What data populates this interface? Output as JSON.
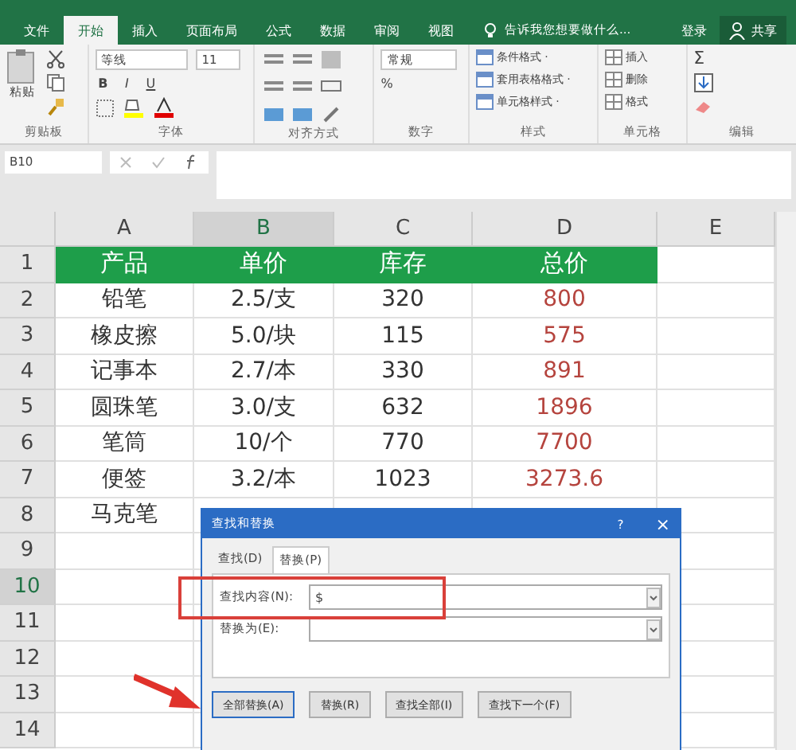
{
  "ribbon_tabs": [
    {
      "label": "文件",
      "selected": false
    },
    {
      "label": "开始",
      "selected": true
    },
    {
      "label": "插入",
      "selected": false
    },
    {
      "label": "页面布局",
      "selected": false
    },
    {
      "label": "公式",
      "selected": false
    },
    {
      "label": "数据",
      "selected": false
    },
    {
      "label": "审阅",
      "selected": false
    },
    {
      "label": "视图",
      "selected": false
    }
  ],
  "tell_me": "告诉我您想要做什么...",
  "sign_in": "登录",
  "share": "共享",
  "ribbon": {
    "paste": "粘贴",
    "font_name": "等线",
    "font_size": "11",
    "bold": "B",
    "italic": "I",
    "underline": "U",
    "number_format": "常规",
    "percent": "%",
    "styles": [
      "条件格式 ·",
      "套用表格格式 ·",
      "单元格样式 ·"
    ],
    "cells": [
      "插入",
      "删除",
      "格式"
    ],
    "sum": "Σ",
    "groups": [
      "剪贴板",
      "字体",
      "对齐方式",
      "数字",
      "样式",
      "单元格",
      "编辑"
    ]
  },
  "name_box": "B10",
  "columns": [
    {
      "label": "A",
      "selected": false,
      "kind": "text"
    },
    {
      "label": "B",
      "selected": true,
      "kind": "text"
    },
    {
      "label": "C",
      "selected": false,
      "kind": "text"
    },
    {
      "label": "D",
      "selected": false,
      "kind": "total"
    },
    {
      "label": "E",
      "selected": false,
      "kind": "text"
    }
  ],
  "rows": [
    {
      "label": "1",
      "selected": false,
      "kind": "header",
      "cells": [
        "产品",
        "单价",
        "库存",
        "总价"
      ]
    },
    {
      "label": "2",
      "selected": false,
      "kind": "data",
      "cells": [
        "铅笔",
        "2.5/支",
        "320",
        "800"
      ]
    },
    {
      "label": "3",
      "selected": false,
      "kind": "data",
      "cells": [
        "橡皮擦",
        "5.0/块",
        "115",
        "575"
      ]
    },
    {
      "label": "4",
      "selected": false,
      "kind": "data",
      "cells": [
        "记事本",
        "2.7/本",
        "330",
        "891"
      ]
    },
    {
      "label": "5",
      "selected": false,
      "kind": "data",
      "cells": [
        "圆珠笔",
        "3.0/支",
        "632",
        "1896"
      ]
    },
    {
      "label": "6",
      "selected": false,
      "kind": "data",
      "cells": [
        "笔筒",
        "10/个",
        "770",
        "7700"
      ]
    },
    {
      "label": "7",
      "selected": false,
      "kind": "data",
      "cells": [
        "便签",
        "3.2/本",
        "1023",
        "3273.6"
      ]
    },
    {
      "label": "8",
      "selected": false,
      "kind": "data",
      "cells": [
        "马克笔"
      ]
    },
    {
      "label": "9",
      "selected": false,
      "kind": "data",
      "cells": []
    },
    {
      "label": "10",
      "selected": true,
      "kind": "data",
      "cells": []
    },
    {
      "label": "11",
      "selected": false,
      "kind": "data",
      "cells": []
    },
    {
      "label": "12",
      "selected": false,
      "kind": "data",
      "cells": []
    },
    {
      "label": "13",
      "selected": false,
      "kind": "data",
      "cells": []
    },
    {
      "label": "14",
      "selected": false,
      "kind": "data",
      "cells": []
    }
  ],
  "dialog": {
    "title": "查找和替换",
    "help": "?",
    "close": "×",
    "tabs": [
      {
        "label": "查找(D)",
        "selected": false
      },
      {
        "label": "替换(P)",
        "selected": true
      }
    ],
    "find_label": "查找内容(N):",
    "find_value": "$",
    "replace_label": "替换为(E):",
    "buttons": [
      "全部替换(A)",
      "替换(R)",
      "查找全部(I)",
      "查找下一个(F)"
    ]
  }
}
